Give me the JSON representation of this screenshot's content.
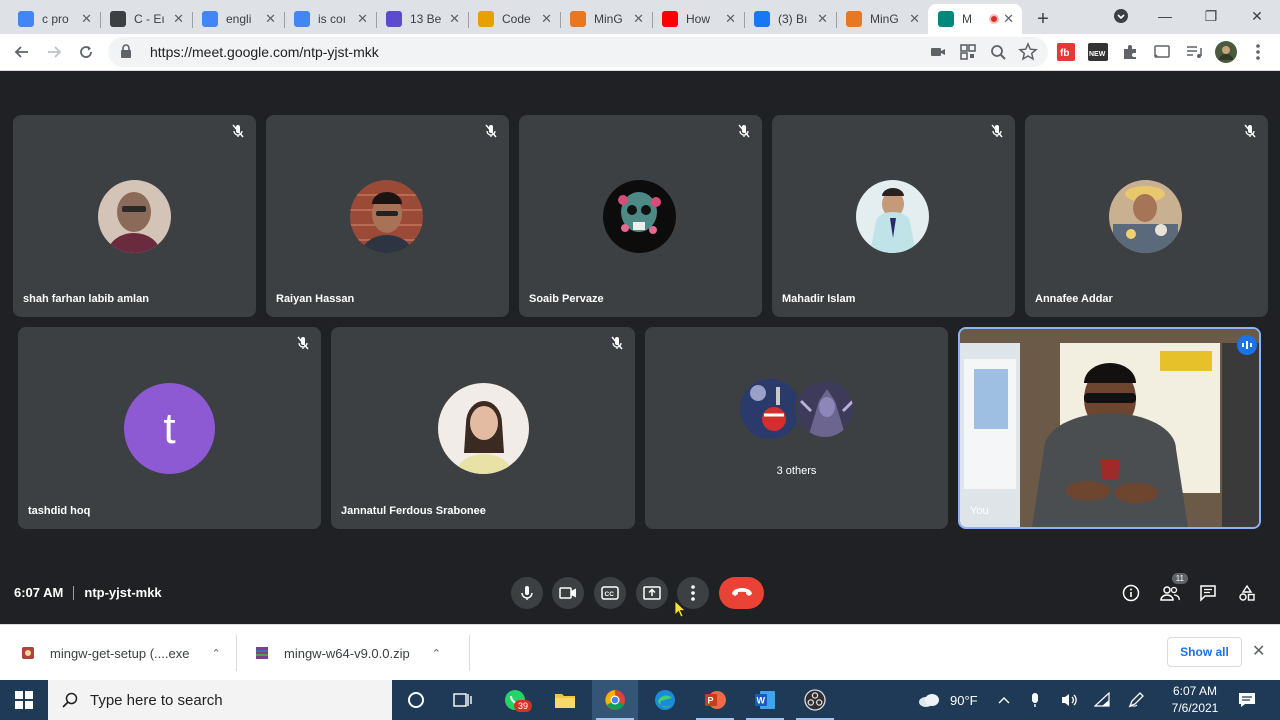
{
  "browser": {
    "tabs": [
      {
        "title": "c pro",
        "favicon": "google-icon",
        "color": "#4285f4",
        "active": false
      },
      {
        "title": "C - Eı",
        "favicon": "diamond-icon",
        "color": "#3c4043",
        "active": false
      },
      {
        "title": "engli",
        "favicon": "google-icon",
        "color": "#4285f4",
        "active": false
      },
      {
        "title": "is coı",
        "favicon": "google-icon",
        "color": "#4285f4",
        "active": false
      },
      {
        "title": "13 Be",
        "favicon": "k-icon",
        "color": "#5c4bcc",
        "active": false
      },
      {
        "title": "Code",
        "favicon": "colorgrid-icon",
        "color": "#e8a000",
        "active": false
      },
      {
        "title": "MinG",
        "favicon": "diamond-orange-icon",
        "color": "#e87722",
        "active": false
      },
      {
        "title": "How",
        "favicon": "youtube-icon",
        "color": "#ff0000",
        "active": false
      },
      {
        "title": "(3) Bı",
        "favicon": "facebook-icon",
        "color": "#1877f2",
        "active": false
      },
      {
        "title": "MinG",
        "favicon": "diamond-orange-icon",
        "color": "#e87722",
        "active": false
      },
      {
        "title": "M",
        "favicon": "meet-icon",
        "color": "#00897b",
        "active": true
      }
    ],
    "url": "https://meet.google.com/ntp-yjst-mkk"
  },
  "participants_row1": [
    {
      "name": "shah farhan labib amlan",
      "avatar_color": "#c9b7a8"
    },
    {
      "name": "Raiyan Hassan",
      "avatar_color": "#8a4a3a"
    },
    {
      "name": "Soaib Pervaze",
      "avatar_color": "#111111"
    },
    {
      "name": "Mahadir Islam",
      "avatar_color": "#d9e7ea"
    },
    {
      "name": "Annafee Addar",
      "avatar_color": "#b89a70"
    }
  ],
  "participants_row2": [
    {
      "name": "tashdid hoq",
      "initial": "t"
    },
    {
      "name": "Jannatul Ferdous Srabonee",
      "avatar_color": "#e9d8cf"
    }
  ],
  "others": {
    "label": "3 others"
  },
  "self": {
    "name": "You"
  },
  "meeting": {
    "time": "6:07 AM",
    "code": "ntp-yjst-mkk",
    "participant_count": "11"
  },
  "downloads": [
    {
      "name": "mingw-get-setup (....exe"
    },
    {
      "name": "mingw-w64-v9.0.0.zip"
    }
  ],
  "shelf": {
    "show_all": "Show all"
  },
  "taskbar": {
    "search_placeholder": "Type here to search",
    "whatsapp_badge": "39",
    "weather": "90°F",
    "time": "6:07 AM",
    "date": "7/6/2021"
  },
  "colors": {
    "meet_bg": "#202124",
    "tile_bg": "#3c4043",
    "end_call": "#ea4335",
    "active_speaker": "#8ab4f8"
  }
}
